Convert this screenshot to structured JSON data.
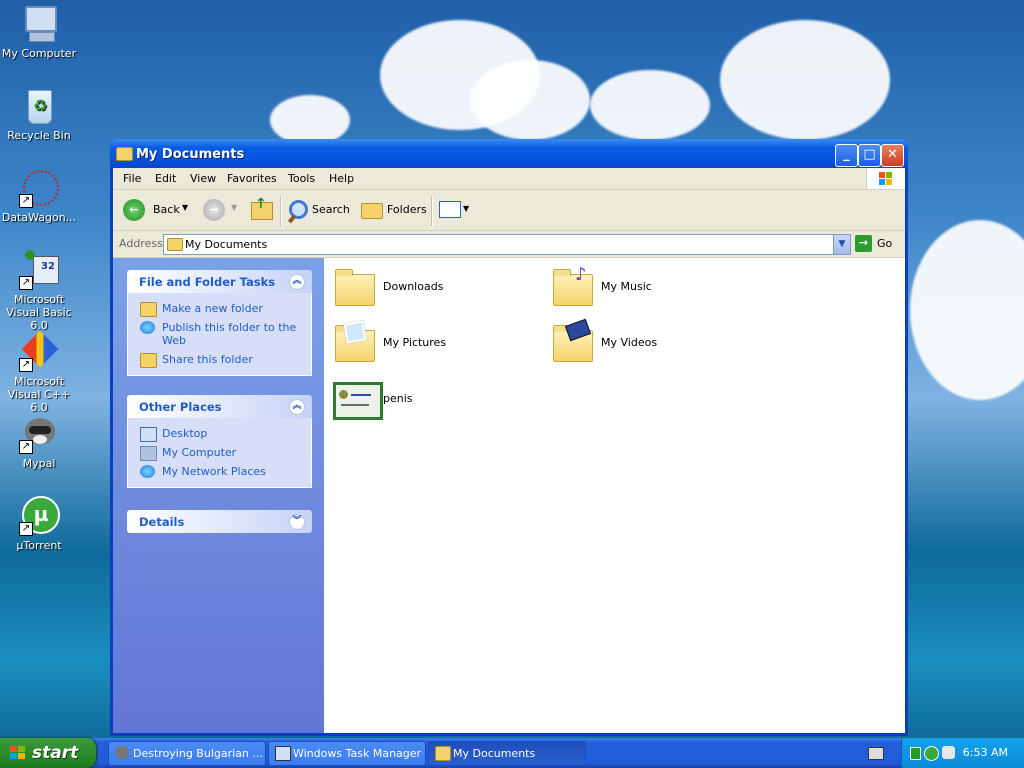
{
  "desktop": {
    "icons": [
      {
        "label": "My Computer",
        "icon": "my-computer-icon",
        "shortcut": false
      },
      {
        "label": "Recycle Bin",
        "icon": "recycle-bin-icon",
        "shortcut": false
      },
      {
        "label": "DataWagon...",
        "icon": "datawagon-icon",
        "shortcut": true
      },
      {
        "label": "Microsoft Visual Basic 6.0",
        "icon": "visual-basic-icon",
        "shortcut": true
      },
      {
        "label": "Microsoft Visual C++ 6.0",
        "icon": "visual-cpp-icon",
        "shortcut": true
      },
      {
        "label": "Mypal",
        "icon": "mypal-icon",
        "shortcut": true
      },
      {
        "label": "µTorrent",
        "icon": "utorrent-icon",
        "shortcut": true
      }
    ]
  },
  "window": {
    "title": "My Documents",
    "menu": [
      "File",
      "Edit",
      "View",
      "Favorites",
      "Tools",
      "Help"
    ],
    "toolbar": {
      "back_label": "Back",
      "search_label": "Search",
      "folders_label": "Folders"
    },
    "address": {
      "label": "Address",
      "value": "My Documents",
      "go_label": "Go"
    },
    "left_pane": {
      "file_tasks": {
        "title": "File and Folder Tasks",
        "items": [
          "Make a new folder",
          "Publish this folder to the Web",
          "Share this folder"
        ]
      },
      "other_places": {
        "title": "Other Places",
        "items": [
          "Desktop",
          "My Computer",
          "My Network Places"
        ]
      },
      "details": {
        "title": "Details"
      }
    },
    "files": [
      {
        "name": "Downloads",
        "icon": "folder-icon"
      },
      {
        "name": "My Music",
        "icon": "music-folder-icon"
      },
      {
        "name": "My Pictures",
        "icon": "pictures-folder-icon"
      },
      {
        "name": "My Videos",
        "icon": "videos-folder-icon"
      },
      {
        "name": "penis",
        "icon": "certificate-file-icon"
      }
    ]
  },
  "taskbar": {
    "start_label": "start",
    "tasks": [
      {
        "label": "Destroying Bulgarian ...",
        "active": false
      },
      {
        "label": "Windows Task Manager",
        "active": false
      },
      {
        "label": "My Documents",
        "active": true
      }
    ],
    "clock": "6:53 AM"
  },
  "colors": {
    "title_bar": "#0553de",
    "task_link": "#215dc6",
    "start_button": "#2f8f2f",
    "tray": "#0d8ad9"
  }
}
